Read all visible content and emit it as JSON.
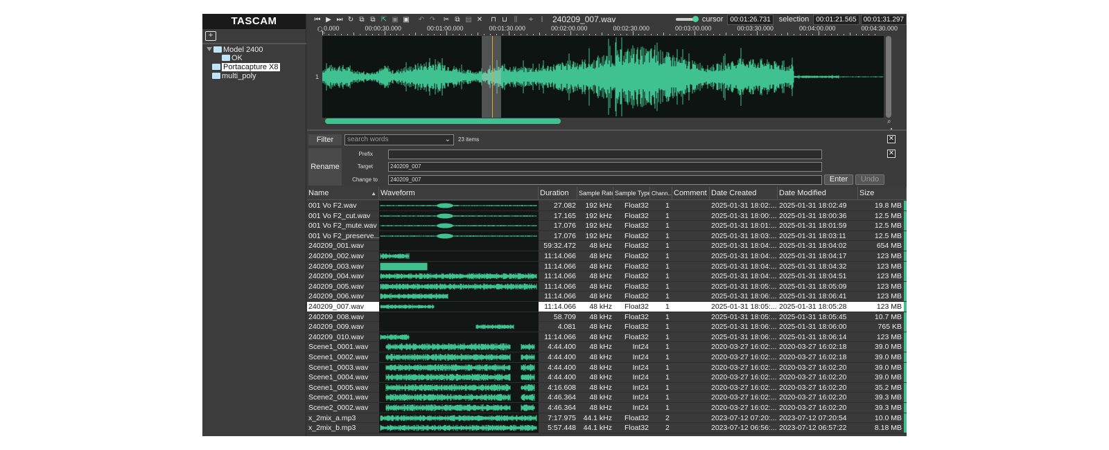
{
  "app": {
    "logo": "TASCAM",
    "file_title": "240209_007.wav",
    "cursor_label": "cursor",
    "cursor_time": "00:01:26.731",
    "selection_label": "selection",
    "selection_start": "00:01:21.565",
    "selection_end": "00:01:31.297",
    "accent_color": "#3fc290"
  },
  "toolbar_icons": [
    "skip-back-icon",
    "play-icon",
    "skip-forward-icon",
    "loop-icon",
    "region-icon",
    "region-add-icon",
    "cursor-select-icon",
    "save-icon",
    "save-all-icon",
    "undo-icon",
    "redo-icon",
    "cut-icon",
    "copy-icon",
    "paste-icon",
    "delete-icon",
    "fade-in-icon",
    "fade-out-icon",
    "silence-icon",
    "split-icon",
    "meter-icon"
  ],
  "sidebar": {
    "tree": [
      {
        "label": "Model 2400",
        "level": 0,
        "expanded": true,
        "selected": false
      },
      {
        "label": "OK",
        "level": 2,
        "selected": false
      },
      {
        "label": "Portacapture X8",
        "level": 1,
        "selected": true
      },
      {
        "label": "multi_poly",
        "level": 1,
        "selected": false
      }
    ]
  },
  "ruler": {
    "labels": [
      "0.000",
      "00:00:30.000",
      "00:01:00.000",
      "00:01:30.000",
      "00:02:00.000",
      "00:02:30.000",
      "00:03:00.000",
      "00:03:30.000",
      "00:04:00.000",
      "00:04:30.000"
    ]
  },
  "waveform": {
    "track_label": "1",
    "selection_fraction": [
      0.284,
      0.318
    ],
    "cursor_fraction": 0.302,
    "scroll_fraction": 0.42
  },
  "filter": {
    "label": "Filter",
    "placeholder": "search words",
    "count": "23 items"
  },
  "rename": {
    "label": "Rename",
    "prefix_label": "Prefix",
    "prefix_value": "",
    "target_label": "Target",
    "target_value": "240209_007",
    "change_label": "Change to",
    "change_value": "240209_007",
    "enter": "Enter",
    "undo": "Undo"
  },
  "table": {
    "headers": {
      "name": "Name",
      "waveform": "Waveform",
      "duration": "Duration",
      "rate": "Sample Rate",
      "type": "Sample Type",
      "chan": "Chann...",
      "comment": "Comment",
      "created": "Date Created",
      "modified": "Date Modified",
      "size": "Size"
    },
    "rows": [
      {
        "name": "001 Vo F2.wav",
        "duration": "27.082",
        "rate": "192 kHz",
        "type": "Float32",
        "chan": "1",
        "comment": "",
        "created": "2025-01-31 18:02:...",
        "modified": "2025-01-31 18:02:49",
        "size": "19.8 MB",
        "wf": "thin"
      },
      {
        "name": "001 Vo F2_cut.wav",
        "duration": "17.165",
        "rate": "192 kHz",
        "type": "Float32",
        "chan": "1",
        "comment": "",
        "created": "2025-01-31 18:00:...",
        "modified": "2025-01-31 18:00:36",
        "size": "12.5 MB",
        "wf": "thin"
      },
      {
        "name": "001 Vo F2_mute.wav",
        "duration": "17.076",
        "rate": "192 kHz",
        "type": "Float32",
        "chan": "1",
        "comment": "",
        "created": "2025-01-31 18:01:...",
        "modified": "2025-01-31 18:01:59",
        "size": "12.5 MB",
        "wf": "thin"
      },
      {
        "name": "001 Vo F2_preserve...",
        "duration": "17.076",
        "rate": "192 kHz",
        "type": "Float32",
        "chan": "1",
        "comment": "",
        "created": "2025-01-31 18:03:...",
        "modified": "2025-01-31 18:03:11",
        "size": "12.5 MB",
        "wf": "thin"
      },
      {
        "name": "240209_001.wav",
        "duration": "59:32.472",
        "rate": "48 kHz",
        "type": "Float32",
        "chan": "1",
        "comment": "",
        "created": "2025-01-31 18:04:...",
        "modified": "2025-01-31 18:04:02",
        "size": "654 MB",
        "wf": "empty"
      },
      {
        "name": "240209_002.wav",
        "duration": "11:14.066",
        "rate": "48 kHz",
        "type": "Float32",
        "chan": "1",
        "comment": "",
        "created": "2025-01-31 18:04:...",
        "modified": "2025-01-31 18:04:17",
        "size": "123 MB",
        "wf": "short"
      },
      {
        "name": "240209_003.wav",
        "duration": "11:14.066",
        "rate": "48 kHz",
        "type": "Float32",
        "chan": "1",
        "comment": "",
        "created": "2025-01-31 18:04:...",
        "modified": "2025-01-31 18:04:32",
        "size": "123 MB",
        "wf": "block"
      },
      {
        "name": "240209_004.wav",
        "duration": "11:14.066",
        "rate": "48 kHz",
        "type": "Float32",
        "chan": "1",
        "comment": "",
        "created": "2025-01-31 18:04:...",
        "modified": "2025-01-31 18:04:51",
        "size": "123 MB",
        "wf": "full"
      },
      {
        "name": "240209_005.wav",
        "duration": "11:14.066",
        "rate": "48 kHz",
        "type": "Float32",
        "chan": "1",
        "comment": "",
        "created": "2025-01-31 18:05:...",
        "modified": "2025-01-31 18:05:09",
        "size": "123 MB",
        "wf": "full"
      },
      {
        "name": "240209_006.wav",
        "duration": "11:14.066",
        "rate": "48 kHz",
        "type": "Float32",
        "chan": "1",
        "comment": "",
        "created": "2025-01-31 18:06:...",
        "modified": "2025-01-31 18:06:41",
        "size": "123 MB",
        "wf": "half"
      },
      {
        "name": "240209_007.wav",
        "duration": "11:14.066",
        "rate": "48 kHz",
        "type": "Float32",
        "chan": "1",
        "comment": "",
        "created": "2025-01-31 18:05:...",
        "modified": "2025-01-31 18:05:28",
        "size": "123 MB",
        "wf": "third",
        "selected": true
      },
      {
        "name": "240209_008.wav",
        "duration": "58.709",
        "rate": "48 kHz",
        "type": "Float32",
        "chan": "1",
        "comment": "",
        "created": "2025-01-31 18:05:...",
        "modified": "2025-01-31 18:05:45",
        "size": "10.7 MB",
        "wf": "empty"
      },
      {
        "name": "240209_009.wav",
        "duration": "4.081",
        "rate": "48 kHz",
        "type": "Float32",
        "chan": "1",
        "comment": "",
        "created": "2025-01-31 18:06:...",
        "modified": "2025-01-31 18:06:00",
        "size": "765 KB",
        "wf": "mid"
      },
      {
        "name": "240209_010.wav",
        "duration": "11:14.066",
        "rate": "48 kHz",
        "type": "Float32",
        "chan": "1",
        "comment": "",
        "created": "2025-01-31 18:06:...",
        "modified": "2025-01-31 18:06:14",
        "size": "123 MB",
        "wf": "short"
      },
      {
        "name": "Scene1_0001.wav",
        "duration": "4:44.400",
        "rate": "48 kHz",
        "type": "Int24",
        "chan": "1",
        "comment": "",
        "created": "2020-03-27 16:02:...",
        "modified": "2020-03-27 16:02:18",
        "size": "39.0 MB",
        "wf": "scene"
      },
      {
        "name": "Scene1_0002.wav",
        "duration": "4:44.400",
        "rate": "48 kHz",
        "type": "Int24",
        "chan": "1",
        "comment": "",
        "created": "2020-03-27 16:02:...",
        "modified": "2020-03-27 16:02:18",
        "size": "39.0 MB",
        "wf": "scene"
      },
      {
        "name": "Scene1_0003.wav",
        "duration": "4:44.400",
        "rate": "48 kHz",
        "type": "Int24",
        "chan": "1",
        "comment": "",
        "created": "2020-03-27 16:02:...",
        "modified": "2020-03-27 16:02:20",
        "size": "39.0 MB",
        "wf": "scene"
      },
      {
        "name": "Scene1_0004.wav",
        "duration": "4:44.400",
        "rate": "48 kHz",
        "type": "Int24",
        "chan": "1",
        "comment": "",
        "created": "2020-03-27 16:02:...",
        "modified": "2020-03-27 16:02:20",
        "size": "39.0 MB",
        "wf": "scene"
      },
      {
        "name": "Scene1_0005.wav",
        "duration": "4:16.608",
        "rate": "48 kHz",
        "type": "Int24",
        "chan": "1",
        "comment": "",
        "created": "2020-03-27 16:02:...",
        "modified": "2020-03-27 16:02:20",
        "size": "35.2 MB",
        "wf": "scene"
      },
      {
        "name": "Scene2_0001.wav",
        "duration": "4:46.364",
        "rate": "48 kHz",
        "type": "Int24",
        "chan": "1",
        "comment": "",
        "created": "2020-03-27 16:02:...",
        "modified": "2020-03-27 16:02:20",
        "size": "39.3 MB",
        "wf": "scene"
      },
      {
        "name": "Scene2_0002.wav",
        "duration": "4:46.364",
        "rate": "48 kHz",
        "type": "Int24",
        "chan": "1",
        "comment": "",
        "created": "2020-03-27 16:02:...",
        "modified": "2020-03-27 16:02:20",
        "size": "39.3 MB",
        "wf": "scene"
      },
      {
        "name": "x_2mix_a.mp3",
        "duration": "7:17.975",
        "rate": "44.1 kHz",
        "type": "Float32",
        "chan": "2",
        "comment": "",
        "created": "2023-07-12 07:20:...",
        "modified": "2023-07-12 07:20:54",
        "size": "10.0 MB",
        "wf": "full"
      },
      {
        "name": "x_2mix_b.mp3",
        "duration": "5:57.448",
        "rate": "44.1 kHz",
        "type": "Float32",
        "chan": "2",
        "comment": "",
        "created": "2023-07-12 06:56:...",
        "modified": "2023-07-12 06:57:22",
        "size": "8.18 MB",
        "wf": "full"
      }
    ]
  }
}
